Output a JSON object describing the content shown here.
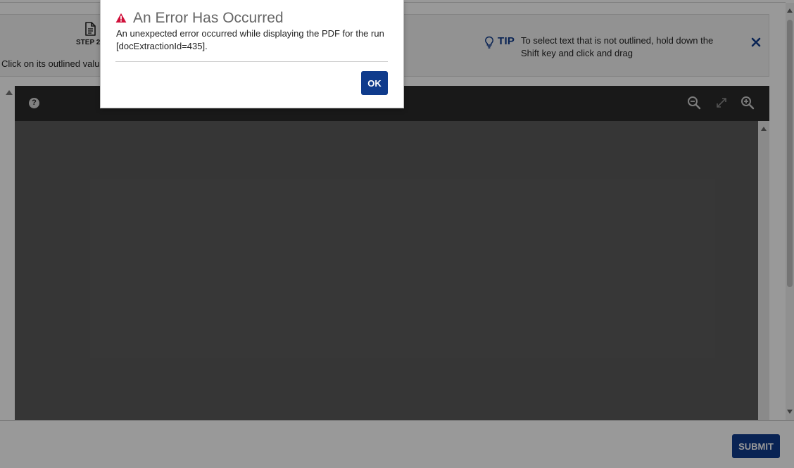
{
  "instruction_panel": {
    "step_label": "STEP 2",
    "instruction_text": "Click on its outlined value",
    "tip_label": "TIP",
    "tip_text": "To select text that is not outlined, hold down the Shift key and click and drag",
    "close_icon": "close-icon",
    "doc_icon": "document-icon",
    "tip_icon": "lightbulb-icon"
  },
  "viewer": {
    "help_label": "?",
    "zoom_out_icon": "zoom-out-icon",
    "fit_icon": "expand-icon",
    "zoom_in_icon": "zoom-in-icon"
  },
  "footer": {
    "submit_label": "SUBMIT"
  },
  "dialog": {
    "title": "An Error Has Occurred",
    "message": "An unexpected error occurred while displaying the PDF for the run [docExtractionId=435].",
    "ok_label": "OK",
    "icon": "warning-icon"
  },
  "colors": {
    "primary": "#0f3b8c",
    "warning": "#d0103a",
    "toolbar": "#2b2b2b",
    "canvas": "#5b5b5b"
  }
}
